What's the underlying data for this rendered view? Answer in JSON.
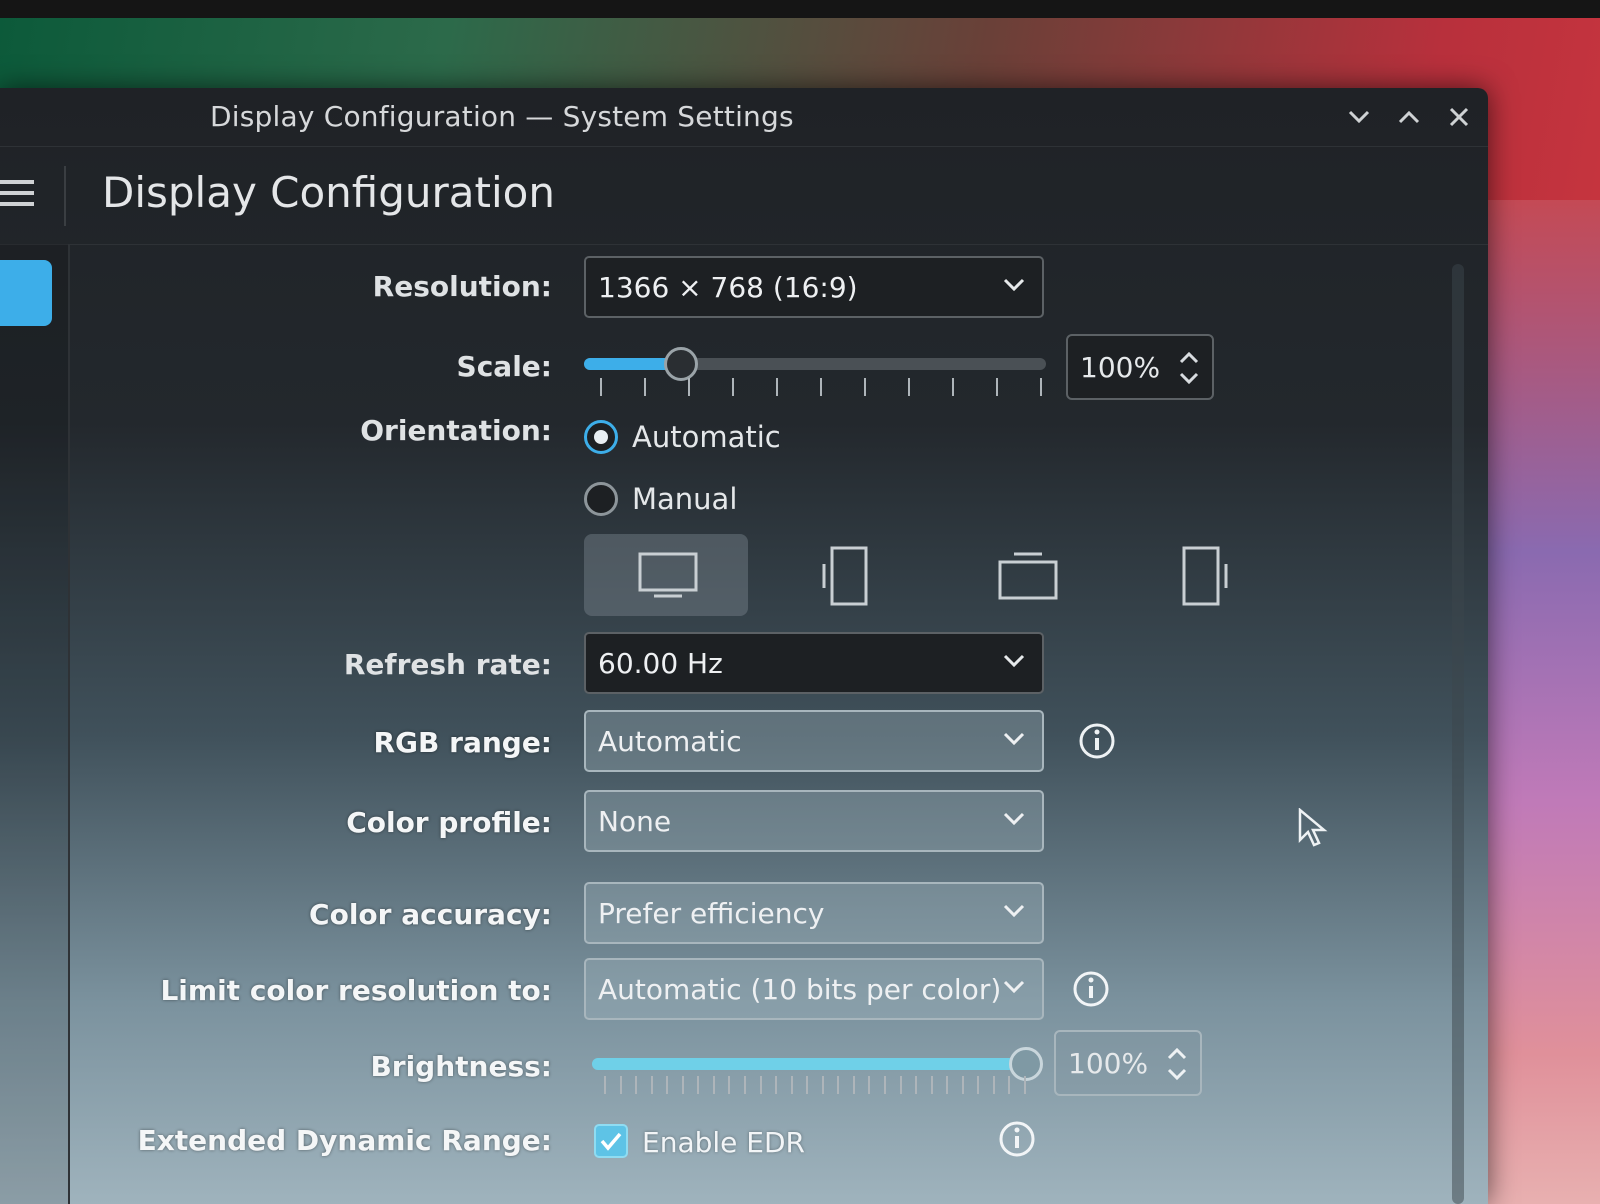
{
  "window": {
    "title": "Display Configuration — System Settings",
    "page_title": "Display Configuration"
  },
  "form": {
    "resolution": {
      "label": "Resolution:",
      "value": "1366 × 768 (16:9)"
    },
    "scale": {
      "label": "Scale:",
      "value_text": "100%",
      "level_fraction": 0.21
    },
    "orientation": {
      "label": "Orientation:",
      "options": [
        "Automatic",
        "Manual"
      ],
      "selected": "Automatic",
      "buttons": [
        "landscape-icon",
        "portrait-left-icon",
        "landscape-flipped-icon",
        "portrait-right-icon"
      ]
    },
    "refresh_rate": {
      "label": "Refresh rate:",
      "value": "60.00 Hz"
    },
    "rgb_range": {
      "label": "RGB range:",
      "value": "Automatic"
    },
    "color_profile": {
      "label": "Color profile:",
      "value": "None"
    },
    "color_accuracy": {
      "label": "Color accuracy:",
      "value": "Prefer efficiency"
    },
    "color_resolution": {
      "label": "Limit color resolution to:",
      "value": "Automatic  (10 bits per color)"
    },
    "brightness": {
      "label": "Brightness:",
      "value_text": "100%",
      "level_fraction": 1.0
    },
    "edr": {
      "label": "Extended Dynamic Range:",
      "checkbox_label": "Enable EDR",
      "checked": true
    }
  },
  "colors": {
    "accent": "#3daee9",
    "window_bg": "#1f2226"
  }
}
